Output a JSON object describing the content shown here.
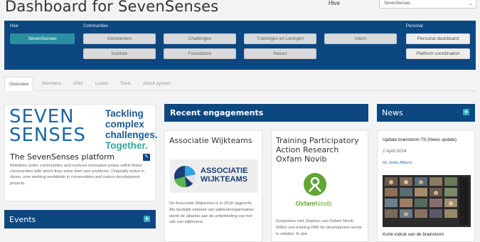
{
  "header": {
    "title": "Dashboard for SevenSenses",
    "hive_label": "Hive",
    "hive_selected": "SevenSenses"
  },
  "nav": {
    "groups": {
      "hive": "Hive",
      "communities": "Communities",
      "personal": "Personal"
    },
    "hive_button": "SevenSenses",
    "community_buttons": [
      "Gemeenten",
      "Challenges",
      "Trainingen en Leringen",
      "Intern",
      "Institute",
      "Foundation",
      "Natuur"
    ],
    "personal_buttons": [
      "Personal dashboard",
      "Platform coordination"
    ]
  },
  "tabs": [
    "Overview",
    "Members",
    "DNA",
    "Loads",
    "Tools",
    "About system"
  ],
  "platform": {
    "logo_line1": "SEVEN",
    "logo_line2": "SENSES",
    "tagline1": "Tackling",
    "tagline2": "complex",
    "tagline3": "challenges.",
    "tagline4": "Together.",
    "title": "The SevenSenses platform",
    "description": "Mobilizes entire communities and nurtures innovative power within these communities with which they solve their own problems. Originally active in slums, now working worldwide in communities and nature development projects."
  },
  "events": {
    "title": "Events"
  },
  "engagements": {
    "title": "Recent engagements",
    "items": [
      {
        "title": "Associatie Wijkteams",
        "logo_text1": "ASSOCIATIE",
        "logo_text2": "WIJKTEAMS",
        "text": "De Associatie Wijkteams is in 2018 opgericht. Als landelijk netwerk van wijkteamorganisaties werkt de alliantie aan de ontwikkeling van het vak van wijkteams."
      },
      {
        "title": "Training Participatory Action Research Oxfam Novib",
        "logo_text1": "Oxfam",
        "logo_text2": "Novib",
        "text": "Gesproken met Stephan van Oxfam Novib. Willen een training PAR for development sector in oktober. Ik doe"
      }
    ]
  },
  "news": {
    "title": "News",
    "items": [
      {
        "title": "Update brainstorm 7S (News update)",
        "date": "2 April 2024",
        "by_label": "By",
        "author": "Jelda Alberts",
        "caption": "Korte indruk van de brainstorm"
      }
    ]
  },
  "colors": {
    "brand_navy": "#0d4780",
    "active_teal": "#2a8fa0",
    "accent_cyan": "#2eb0c4",
    "oxfam_green": "#61a534"
  }
}
